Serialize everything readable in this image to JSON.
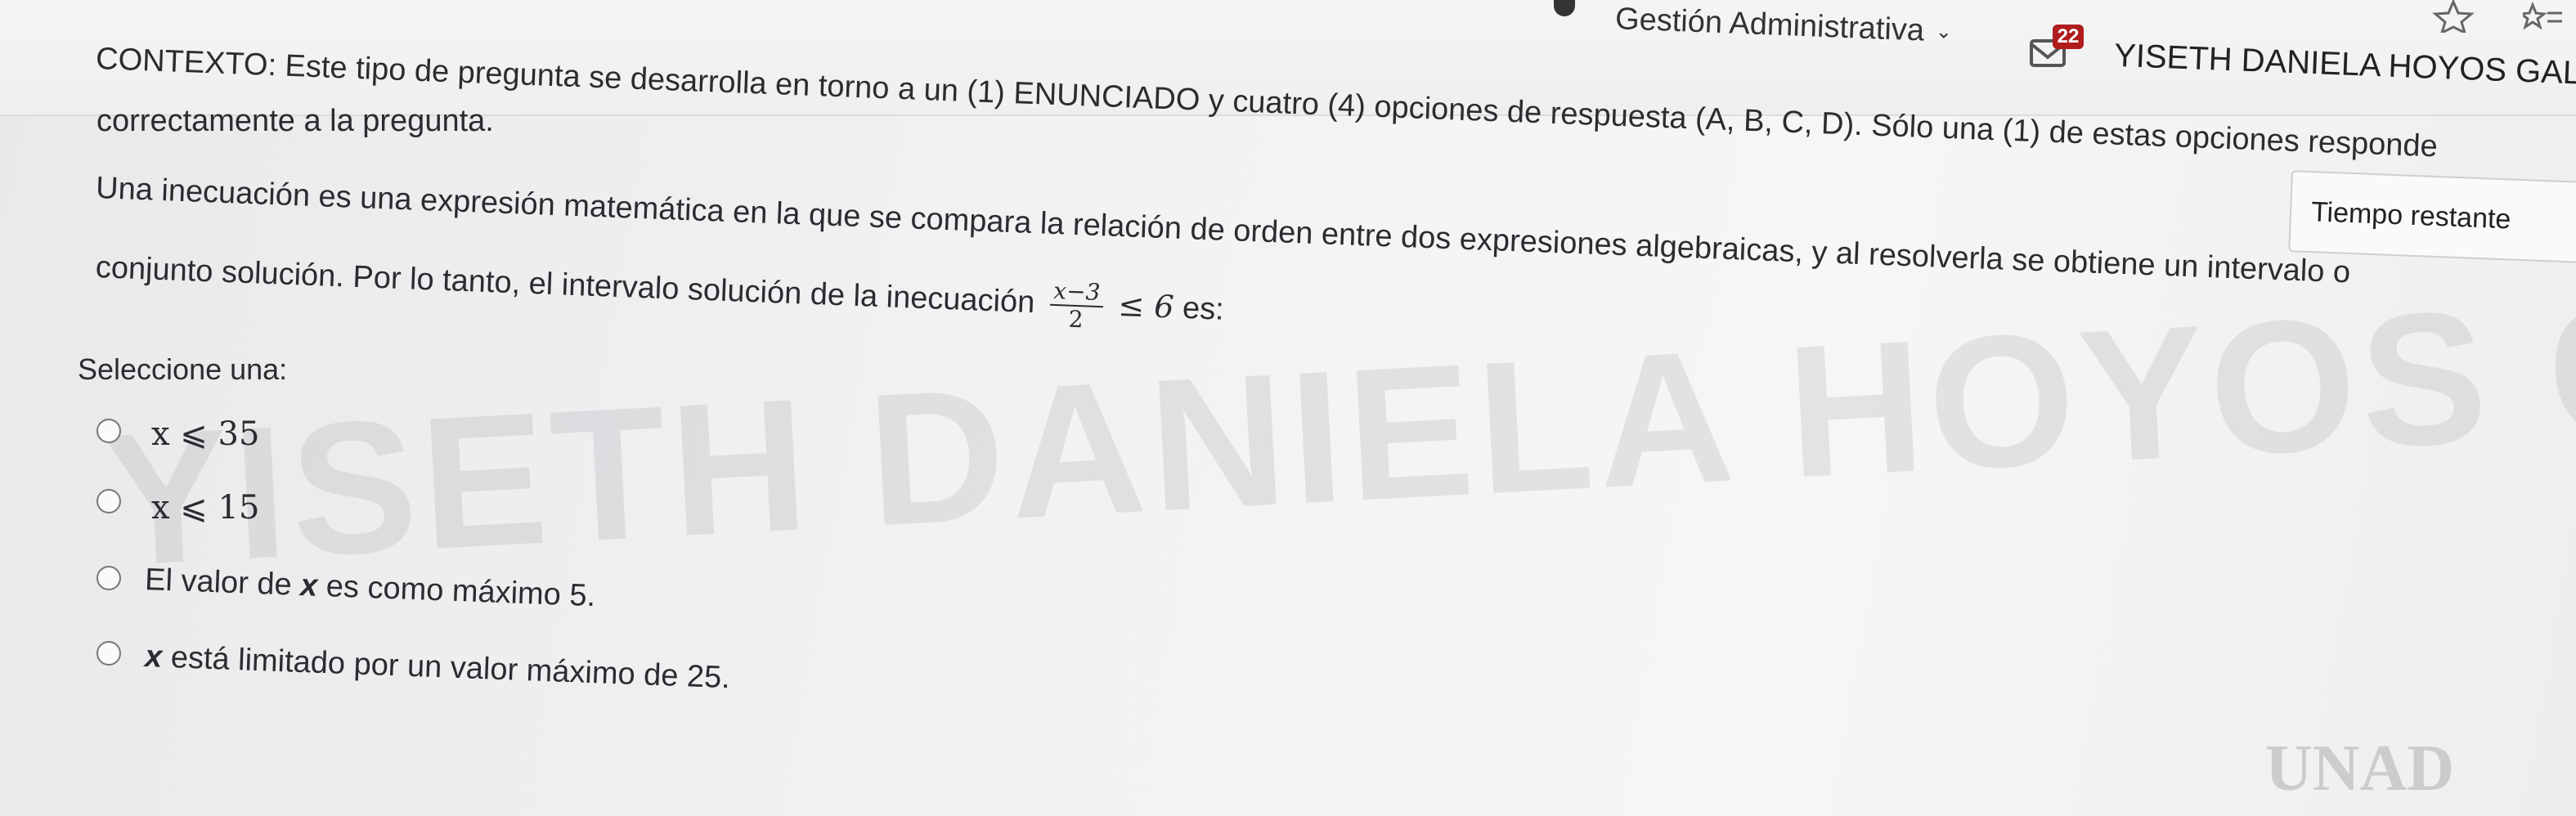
{
  "header": {
    "nav_menu_label": "Gestión Administrativa",
    "message_count": "22",
    "user_name": "YISETH DANIELA HOYOS GALIND"
  },
  "timer": {
    "label": "Tiempo restante"
  },
  "question": {
    "context_line1": "CONTEXTO: Este tipo de pregunta se desarrolla en torno a un (1) ENUNCIADO y cuatro (4) opciones de respuesta (A, B, C, D). Sólo una (1) de estas opciones responde",
    "context_line2": "correctamente a la pregunta.",
    "statement_line1": "Una inecuación es una expresión matemática en la que se compara la relación de orden entre dos expresiones algebraicas, y al resolverla se obtiene un intervalo o",
    "statement_line2_prefix": "conjunto solución. Por lo tanto, el intervalo solución de la inecuación",
    "fraction_numerator": "x−3",
    "fraction_denominator": "2",
    "inequality_rhs": "≤ 6",
    "statement_line2_suffix": "es:",
    "select_prompt": "Seleccione una:"
  },
  "options": [
    {
      "text": "x ⩽ 35"
    },
    {
      "text": "x ⩽ 15"
    },
    {
      "prefix": "El valor de ",
      "var": "x",
      "suffix": " es como máximo 5."
    },
    {
      "var": "x",
      "suffix": " está limitado por un valor máximo de 25."
    }
  ],
  "watermark": {
    "text": "YISETH DANIELA HOYOS GALINDEZ"
  },
  "logo": {
    "text": "UNAD"
  }
}
